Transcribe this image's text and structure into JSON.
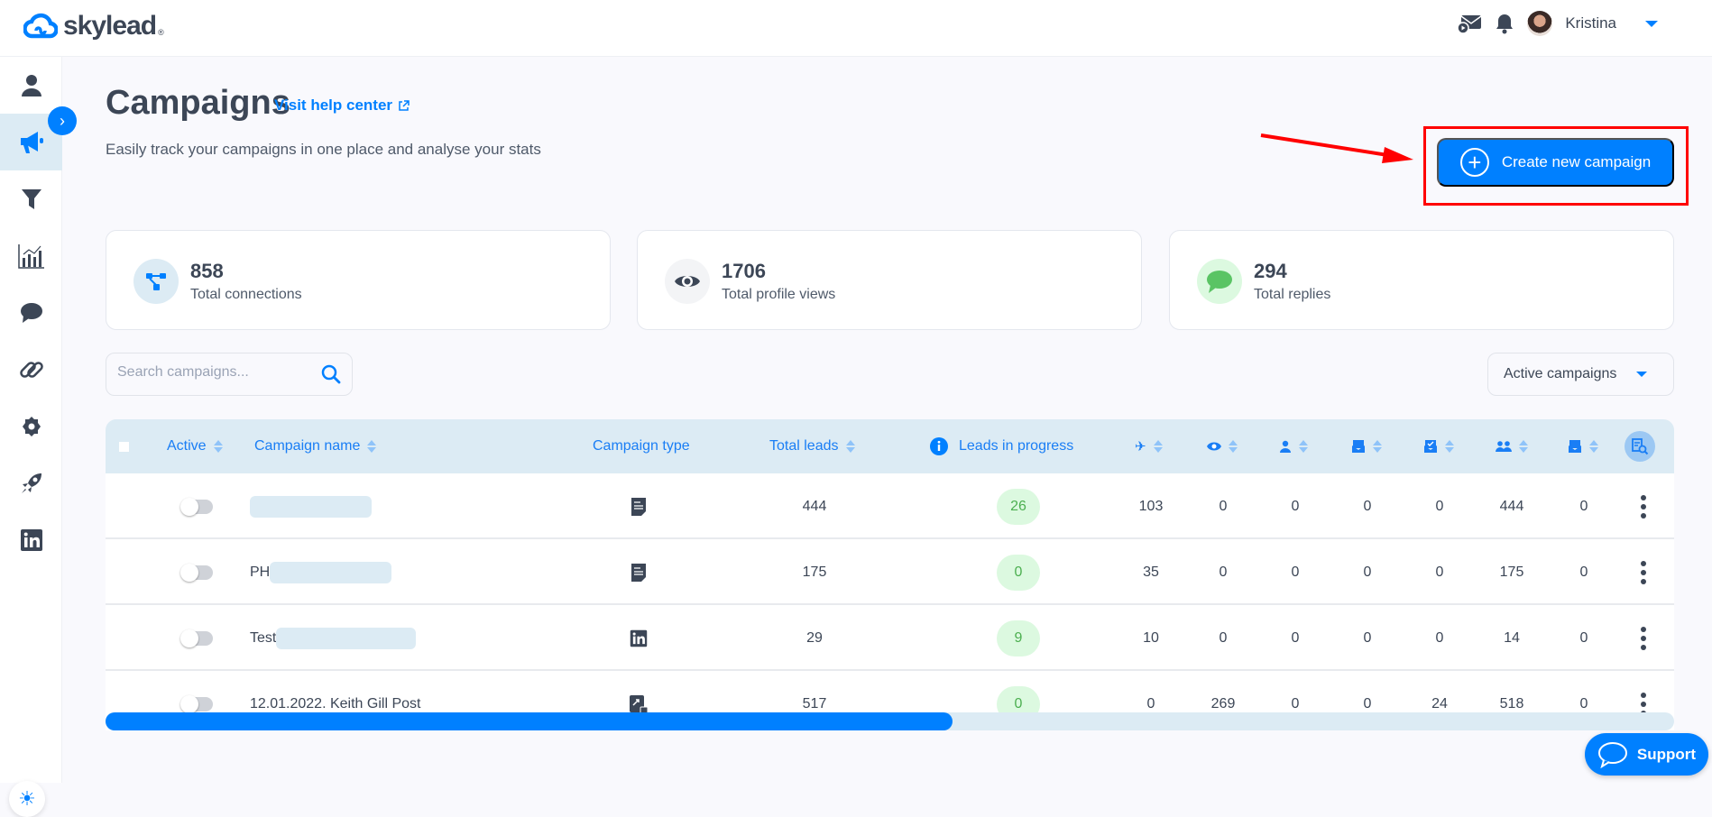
{
  "app": {
    "logo_text": "skylead",
    "logo_reg": "®",
    "user_name": "Kristina"
  },
  "topbar": {
    "icons": [
      "mail-play-icon",
      "bell-icon",
      "avatar"
    ]
  },
  "sidebar": {
    "items": [
      {
        "name": "profile",
        "icon": "user-icon"
      },
      {
        "name": "campaigns",
        "icon": "megaphone-icon",
        "active": true
      },
      {
        "name": "leads-filter",
        "icon": "filter-icon"
      },
      {
        "name": "statistics",
        "icon": "chart-icon"
      },
      {
        "name": "inbox",
        "icon": "chat-icon"
      },
      {
        "name": "integrations",
        "icon": "link-icon"
      },
      {
        "name": "settings",
        "icon": "gear-icon"
      },
      {
        "name": "boost",
        "icon": "rocket-icon"
      },
      {
        "name": "linkedin-accounts",
        "icon": "linkedin-icon"
      }
    ],
    "expand_label": "›",
    "theme_icon": "☀"
  },
  "page": {
    "title": "Campaigns",
    "help_link": "Visit help center",
    "subtitle": "Easily track your campaigns in one place and analyse your stats",
    "create_button": "Create new campaign"
  },
  "stats": [
    {
      "value": "858",
      "label": "Total connections"
    },
    {
      "value": "1706",
      "label": "Total profile views"
    },
    {
      "value": "294",
      "label": "Total replies"
    }
  ],
  "search": {
    "placeholder": "Search campaigns...",
    "value": ""
  },
  "filter": {
    "selected": "Active campaigns"
  },
  "table": {
    "headers": {
      "active": "Active",
      "name": "Campaign name",
      "type": "Campaign type",
      "total_leads": "Total leads",
      "in_progress": "Leads in progress"
    },
    "icon_columns": [
      "invites-sent-icon",
      "profile-views-icon",
      "follows-icon",
      "email-sent-icon",
      "email-verified-icon",
      "connections-icon",
      "email-replies-icon"
    ],
    "rows": [
      {
        "active": false,
        "name": "",
        "name_redacted": true,
        "type": "csv",
        "total_leads": "444",
        "in_progress": "26",
        "stats": [
          "103",
          "0",
          "0",
          "0",
          "0",
          "444",
          "0"
        ]
      },
      {
        "active": false,
        "name": "PH",
        "name_redacted": true,
        "type": "csv",
        "total_leads": "175",
        "in_progress": "0",
        "stats": [
          "35",
          "0",
          "0",
          "0",
          "0",
          "175",
          "0"
        ]
      },
      {
        "active": false,
        "name": "Test",
        "name_redacted": true,
        "type": "linkedin",
        "total_leads": "29",
        "in_progress": "9",
        "stats": [
          "10",
          "0",
          "0",
          "0",
          "0",
          "14",
          "0"
        ]
      },
      {
        "active": false,
        "name": "12.01.2022. Keith Gill Post",
        "name_redacted": false,
        "type": "post-engagement",
        "total_leads": "517",
        "in_progress": "0",
        "stats": [
          "0",
          "269",
          "0",
          "0",
          "24",
          "518",
          "0"
        ]
      }
    ]
  },
  "scrollbar": {
    "position_fraction": 0.54
  },
  "support": {
    "label": "Support"
  },
  "colors": {
    "accent": "#0080ff",
    "header_bg": "#dcebf4",
    "pill_bg": "#dcf9e0",
    "pill_text": "#4caf50",
    "annotation": "#ff0000"
  }
}
